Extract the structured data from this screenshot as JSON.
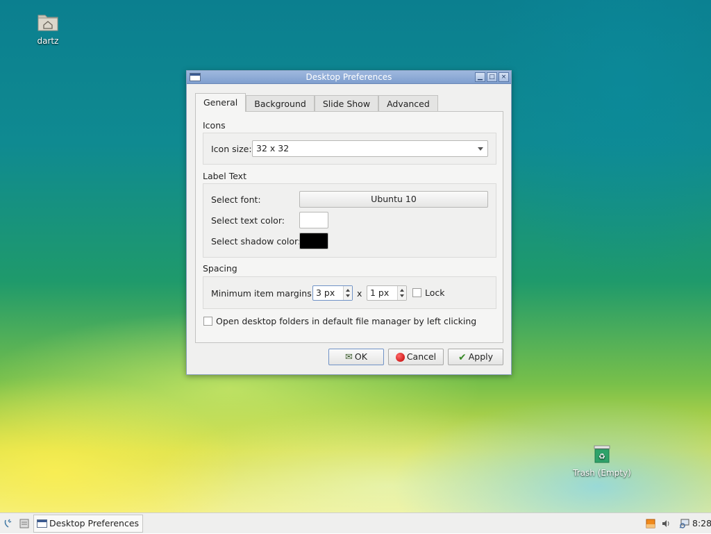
{
  "desktop": {
    "home_icon_label": "dartz",
    "trash_icon_label": "Trash (Empty)"
  },
  "window": {
    "title": "Desktop Preferences",
    "controls": {
      "minimize": "▁",
      "maximize": "□",
      "close": "×"
    }
  },
  "tabs": [
    {
      "label": "General",
      "active": true
    },
    {
      "label": "Background",
      "active": false
    },
    {
      "label": "Slide Show",
      "active": false
    },
    {
      "label": "Advanced",
      "active": false
    }
  ],
  "icons_section": {
    "title": "Icons",
    "icon_size_label": "Icon size:",
    "icon_size_value": "32 x 32"
  },
  "label_text_section": {
    "title": "Label Text",
    "font_label": "Select font:",
    "font_value": "Ubuntu 10",
    "text_color_label": "Select text color:",
    "text_color": "#ffffff",
    "shadow_color_label": "Select shadow color:",
    "shadow_color": "#000000"
  },
  "spacing_section": {
    "title": "Spacing",
    "margins_label": "Minimum item margins:",
    "margin_x_value": "3 px",
    "separator": "x",
    "margin_y_value": "1 px",
    "lock_label": "Lock",
    "lock_checked": false
  },
  "open_folders_label": "Open desktop folders in default file manager by left clicking",
  "open_folders_checked": false,
  "buttons": {
    "ok": "OK",
    "cancel": "Cancel",
    "apply": "Apply"
  },
  "taskbar": {
    "window_button_label": "Desktop Preferences",
    "clock": "8:28"
  },
  "colors": {
    "titlebar": "#8aa9d8",
    "window_bg": "#f0f0ef",
    "accent": "#6f92c6"
  }
}
